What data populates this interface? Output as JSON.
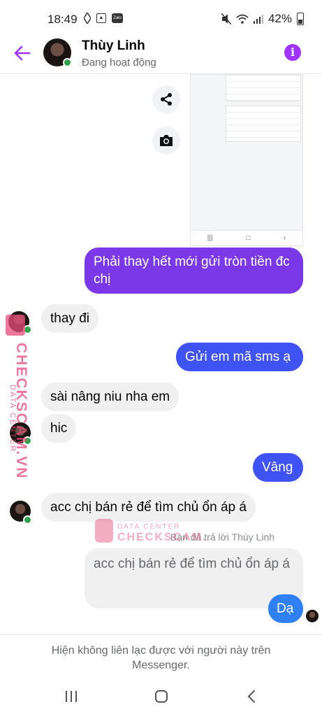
{
  "status": {
    "time": "18:49",
    "zalo_label": "Zalo",
    "battery": "42%"
  },
  "header": {
    "contact_name": "Thùy Linh",
    "presence": "Đang hoạt động"
  },
  "messages": [
    {
      "direction": "out",
      "text": "Phải thay hết mới gửi tròn tiền đc chị"
    },
    {
      "direction": "in",
      "text": "thay đi"
    },
    {
      "direction": "out",
      "text": "Gửi em mã sms ạ"
    },
    {
      "direction": "in",
      "text": "sài nâng niu nha em"
    },
    {
      "direction": "in",
      "text": "hic"
    },
    {
      "direction": "out",
      "text": "Vâng"
    },
    {
      "direction": "in",
      "text": "acc chị bán rẻ để tìm chủ ổn áp á"
    },
    {
      "direction": "out",
      "text": "Dạ"
    }
  ],
  "reply": {
    "note": "Bạn đã trả lời Thùy Linh",
    "quoted_text": "acc chị bán rẻ để tìm chủ ổn áp á"
  },
  "footer": {
    "notice": "Hiện không liên lạc được với người này trên Messenger."
  },
  "watermark": {
    "top_line": "DATA CENTER",
    "brand": "CHECKSCAM.VN",
    "brand_partial": "CHECKSCAM."
  },
  "colors": {
    "accent": "#a033ff",
    "outgoing_purple": "#7b38e8",
    "outgoing_blue": "#3f52f3",
    "online": "#31a24c",
    "watermark": "#e84b7a"
  }
}
